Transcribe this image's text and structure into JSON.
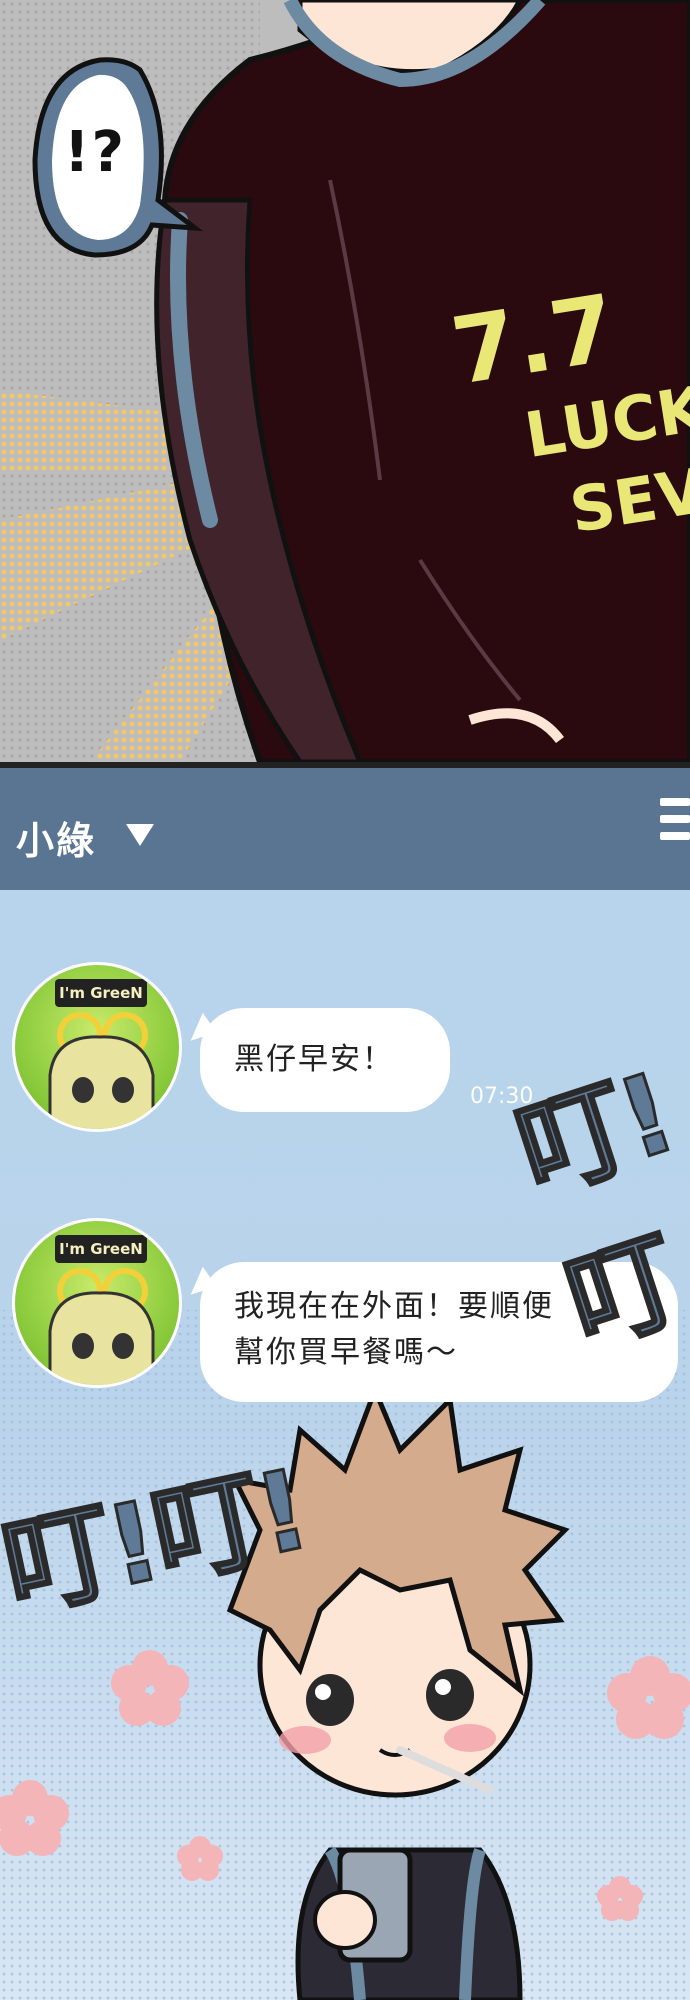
{
  "panel_top": {
    "speech_bubble_text": "!?",
    "shirt_print": {
      "line1": "7.7",
      "line2": "LUCK",
      "line3": "SEV"
    }
  },
  "chat_header": {
    "title": "小綠",
    "dropdown_icon": "triangle-down-icon",
    "menu_icon": "hamburger-menu-icon"
  },
  "messages": [
    {
      "sender_avatar_tag": "I'm GreeN",
      "text": "黑仔早安！",
      "time": "07:30"
    },
    {
      "sender_avatar_tag": "I'm GreeN",
      "text_lines": [
        "我現在在外面！要順便",
        "幫你買早餐嗎～"
      ]
    }
  ],
  "sound_effects": {
    "sfx_right": "叮!叮",
    "sfx_left": "叮!叮!"
  },
  "colors": {
    "header": "#5a7591",
    "chat_bg": "#b8d4ec",
    "bubble": "#ffffff",
    "sfx": "#5e7a97",
    "shirt": "#2a0a0f",
    "shirt_print": "#e9e877"
  }
}
